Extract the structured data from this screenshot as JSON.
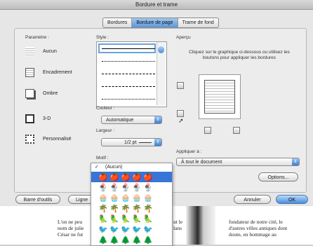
{
  "window": {
    "title": "Bordure et trame"
  },
  "tabs": [
    {
      "label": "Bordures",
      "active": false
    },
    {
      "label": "Bordure de page",
      "active": true
    },
    {
      "label": "Trame de fond",
      "active": false
    }
  ],
  "setting": {
    "heading": "Paramètre :",
    "items": [
      {
        "label": "Aucun"
      },
      {
        "label": "Encadrement"
      },
      {
        "label": "Ombre"
      },
      {
        "label": "3-D"
      },
      {
        "label": "Personnalisé"
      }
    ]
  },
  "style": {
    "heading": "Style :"
  },
  "color": {
    "heading": "Couleur :",
    "value": "Automatique"
  },
  "width": {
    "heading": "Largeur :",
    "value": "1/2 pt"
  },
  "motif": {
    "heading": "Motif :",
    "items": [
      {
        "label": "(Aucun)",
        "checked": true
      },
      {
        "label": "",
        "selected": true,
        "glyph": "🍎"
      },
      {
        "glyph": "🍨"
      },
      {
        "glyph": "🧁"
      },
      {
        "glyph": "🌴"
      },
      {
        "glyph": "🦜"
      },
      {
        "glyph": "🐦"
      },
      {
        "glyph": "🌲"
      }
    ]
  },
  "preview": {
    "heading": "Aperçu",
    "instructions": "Cliquez sur le graphique ci-dessous ou utilisez les boutons pour appliquer les bordures"
  },
  "apply_to": {
    "heading": "Appliquer à :",
    "value": "À tout le document"
  },
  "buttons": {
    "options": "Options...",
    "toolbar": "Barre d'outils",
    "horizontal_line": "Ligne",
    "cancel": "Annuler",
    "ok": "OK"
  },
  "document": {
    "col1": "L'on ne peu\nnom de julie\nCésar ne fut",
    "col2": "ut le\nlans",
    "col3": "fondateur de notre cité, le\nd'autres villes antiques dont\ndoute, en hommage au"
  },
  "colors": {
    "accent": "#3875d7",
    "selected_tab": "#6aa3e0"
  }
}
